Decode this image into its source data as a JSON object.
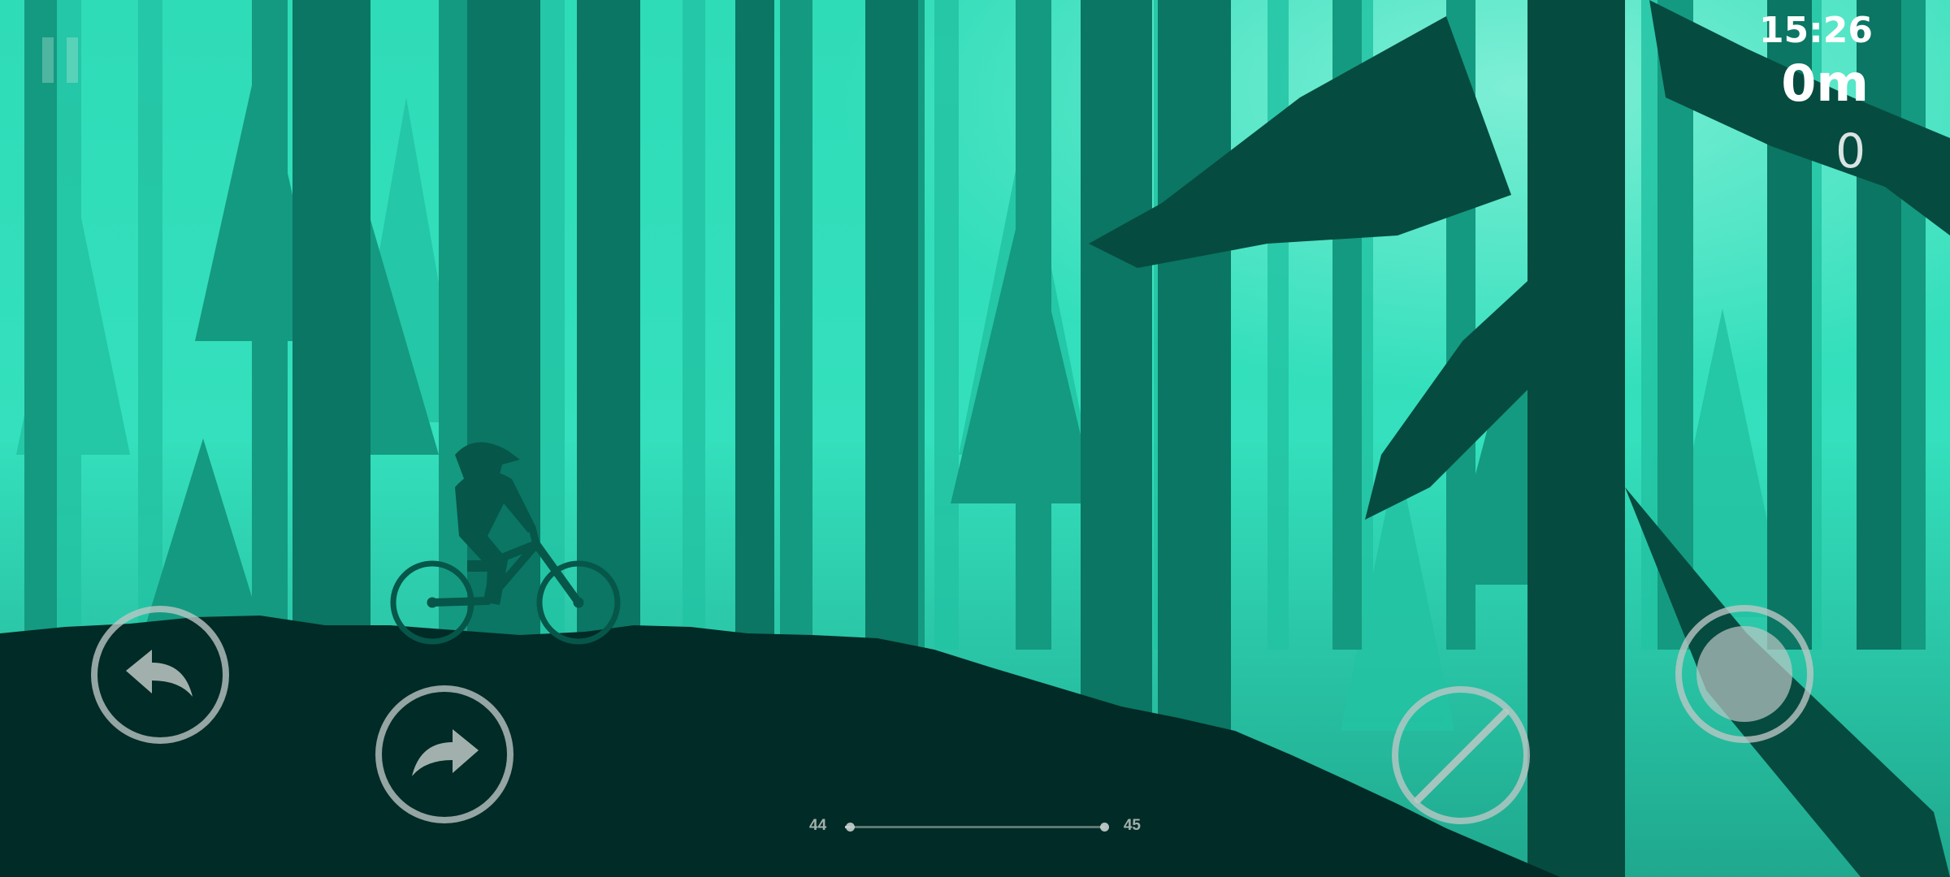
{
  "hud": {
    "clock": "15:26",
    "distance": "0m",
    "score": "0"
  },
  "level_progress": {
    "current_level": "44",
    "next_level": "45",
    "progress_fraction": 0.02
  },
  "controls": {
    "lean_back": "lean-back-arrow-icon",
    "lean_forward": "lean-forward-arrow-icon",
    "brake": "brake-slash-icon",
    "pedal": "pedal-circle-icon",
    "pause": "pause-icon"
  },
  "colors": {
    "sky": "#3fe8c4",
    "ground": "#012b26",
    "control_ring": "#bec8c6"
  }
}
